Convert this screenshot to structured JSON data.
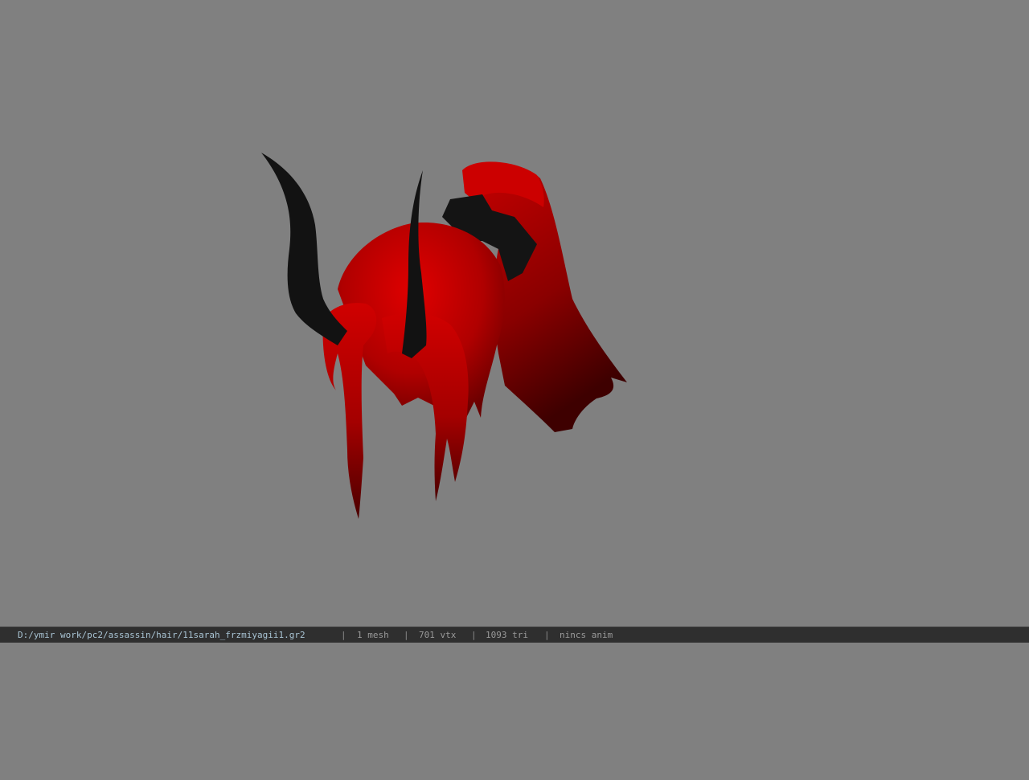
{
  "viewer": {
    "background_color": "#808080",
    "model_colors": {
      "hair_bright": "#c80000",
      "hair_dark": "#5a0000",
      "horn": "#111111"
    }
  },
  "statusbar": {
    "file_path": "D:/ymir work/pc2/assassin/hair/11sarah_frzmiyagii1.gr2",
    "separator": "|",
    "mesh_count": "1 mesh",
    "vertex_count": "701 vtx",
    "triangle_count": "1093 tri",
    "anim_status": "nincs anim"
  }
}
